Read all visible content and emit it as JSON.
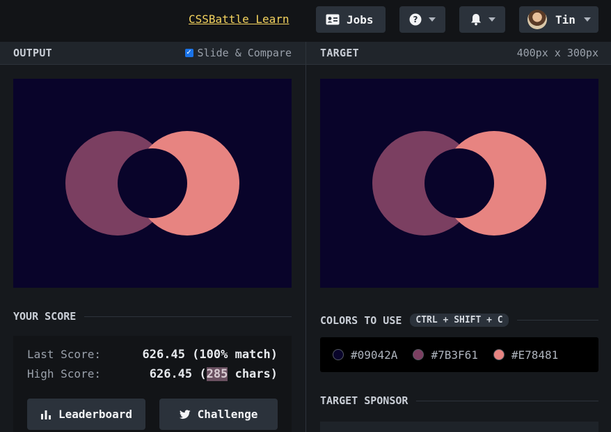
{
  "header": {
    "learn_link": "CSSBattle Learn",
    "jobs_label": "Jobs",
    "user_name": "Tin"
  },
  "output_panel": {
    "title": "OUTPUT",
    "compare_label": "Slide & Compare",
    "compare_checked": true
  },
  "target_panel": {
    "title": "TARGET",
    "dimensions": "400px x 300px"
  },
  "colors": {
    "background": "#09042A",
    "left_circle": "#7B3F61",
    "right_circle": "#E78481"
  },
  "score": {
    "title": "YOUR SCORE",
    "last_label": "Last Score:",
    "last_value": "626.45 (100% match)",
    "high_label": "High Score:",
    "high_value_prefix": "626.45 (",
    "high_chars": "285",
    "high_value_suffix": " chars)",
    "leaderboard_label": "Leaderboard",
    "challenge_label": "Challenge"
  },
  "colors_section": {
    "title": "COLORS TO USE",
    "shortcut": "CTRL + SHIFT + C",
    "items": [
      {
        "hex": "#09042A",
        "label": "#09042A"
      },
      {
        "hex": "#7B3F61",
        "label": "#7B3F61"
      },
      {
        "hex": "#E78481",
        "label": "#E78481"
      }
    ]
  },
  "sponsor": {
    "title": "TARGET SPONSOR"
  },
  "icons": [
    "id-card-icon",
    "help-icon",
    "bell-icon",
    "avatar",
    "chevron-down-icon",
    "bar-chart-icon",
    "twitter-icon"
  ]
}
